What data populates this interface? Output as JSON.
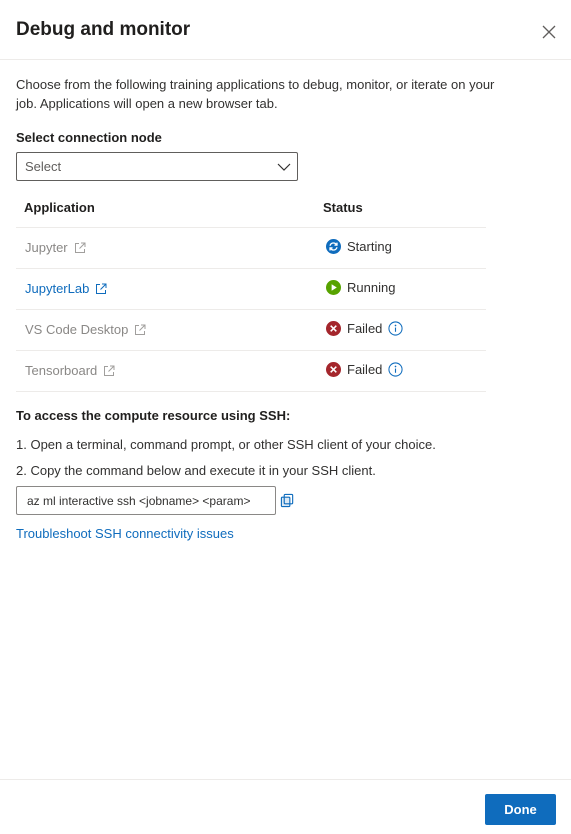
{
  "panel": {
    "title": "Debug and monitor",
    "intro": "Choose from the following training applications to debug, monitor, or iterate on your job. Applications will open a new browser tab."
  },
  "connection": {
    "label": "Select connection node",
    "value": "Select"
  },
  "table": {
    "headers": {
      "application": "Application",
      "status": "Status"
    },
    "rows": [
      {
        "app": "Jupyter",
        "status": "Starting"
      },
      {
        "app": "JupyterLab",
        "status": "Running"
      },
      {
        "app": "VS Code Desktop",
        "status": "Failed"
      },
      {
        "app": "Tensorboard",
        "status": "Failed"
      }
    ]
  },
  "ssh": {
    "title": "To access the compute resource using SSH:",
    "step1": "1. Open a terminal, command prompt, or other SSH client of your choice.",
    "step2": "2. Copy the command below and execute it in your SSH client.",
    "command": "az ml interactive ssh <jobname> <param>",
    "troubleshoot": "Troubleshoot SSH connectivity issues"
  },
  "footer": {
    "done_label": "Done"
  },
  "colors": {
    "accent": "#0f6cbd",
    "starting": "#0f6cbd",
    "running": "#57a300",
    "failed": "#a4262c"
  }
}
